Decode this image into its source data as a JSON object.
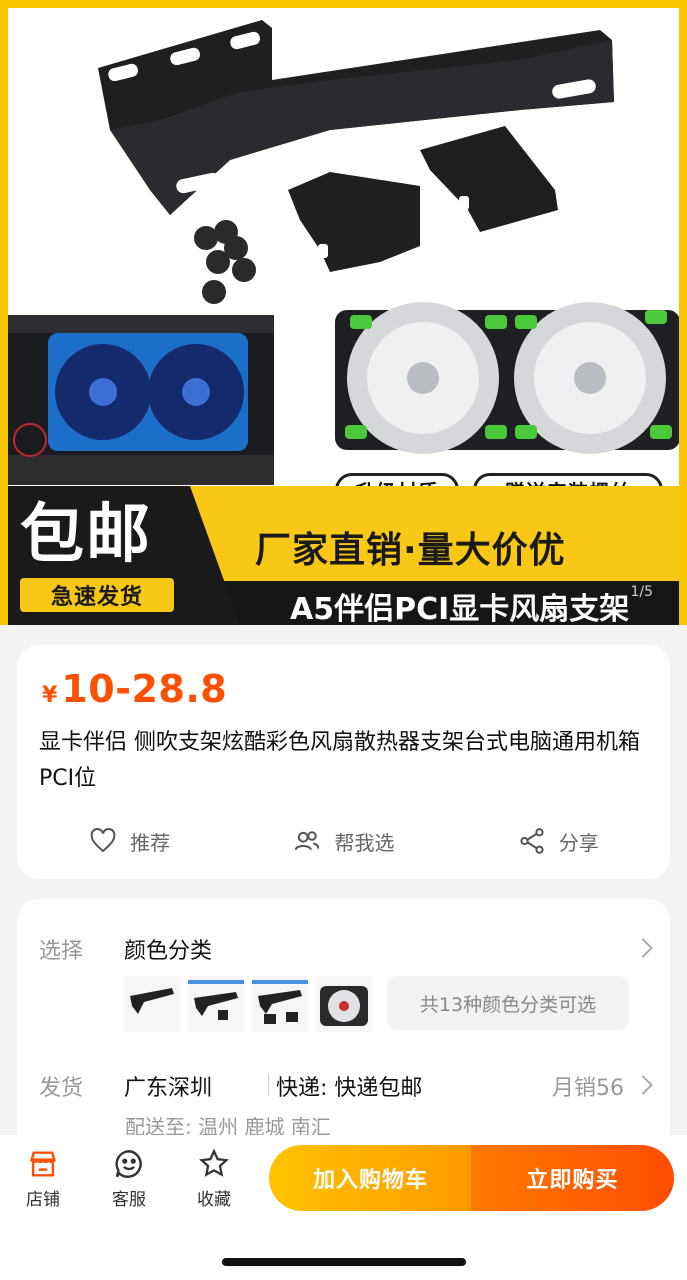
{
  "hero": {
    "tag_material": "升级材质",
    "tag_screws": "赠送安装螺丝",
    "badge_main": "包邮",
    "badge_sub": "急速发货",
    "headline": "厂家直销·量大价优",
    "product_line": "A5伴侣PCI显卡风扇支架",
    "page_indicator": "1/5"
  },
  "product": {
    "currency": "¥",
    "price_range": "10-28.8",
    "title": "显卡伴侣 侧吹支架炫酷彩色风扇散热器支架台式电脑通用机箱PCI位",
    "actions": {
      "recommend": "推荐",
      "help_choose": "帮我选",
      "share": "分享"
    }
  },
  "sku": {
    "select_label": "选择",
    "select_value": "颜色分类",
    "options_hint": "共13种颜色分类可选",
    "shipping_label": "发货",
    "origin": "广东深圳",
    "courier": "快递: 快递包邮",
    "monthly_sales": "月销56",
    "deliver_to": "配送至: 温州 鹿城 南汇"
  },
  "bottom_bar": {
    "store": "店铺",
    "service": "客服",
    "favorite": "收藏",
    "add_to_cart": "加入购物车",
    "buy_now": "立即购买"
  },
  "colors": {
    "accent": "#ff5000",
    "banner_yellow": "#f9c816",
    "cart_button": "#ffb000",
    "buy_button": "#ff5a00"
  },
  "icons": [
    "heart-icon",
    "people-icon",
    "share-icon",
    "store-icon",
    "service-icon",
    "star-icon",
    "chevron-right-icon"
  ]
}
